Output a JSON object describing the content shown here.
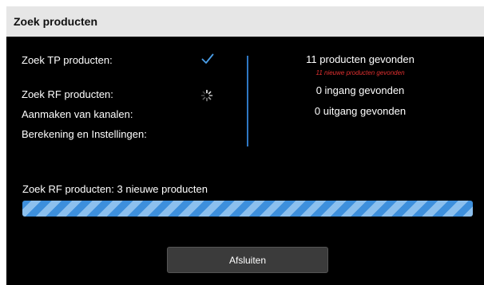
{
  "dialog": {
    "title": "Zoek producten"
  },
  "steps": [
    {
      "label": "Zoek TP producten:",
      "state": "done",
      "icon": "check-icon"
    },
    {
      "label": "Zoek RF producten:",
      "state": "in-progress",
      "icon": "spinner-icon"
    },
    {
      "label": "Aanmaken van kanalen:",
      "state": "pending"
    },
    {
      "label": "Berekening en Instellingen:",
      "state": "pending"
    }
  ],
  "results": {
    "products_found": "11 producten gevonden",
    "new_products_note": "11 nieuwe producten gevonden",
    "inputs_found": "0 ingang gevonden",
    "outputs_found": "0 uitgang gevonden"
  },
  "status": {
    "text": "Zoek RF producten: 3 nieuwe producten",
    "progress_percent": 100,
    "progress_style": "striped-indeterminate"
  },
  "footer": {
    "close_label": "Afsluiten"
  },
  "colors": {
    "background": "#000000",
    "titlebar": "#e6e6e6",
    "accent": "#2f78c4",
    "progress_light": "#8cc0ee",
    "progress_dark": "#3d8fdc",
    "note": "#e03030",
    "button": "#3b3b3b"
  }
}
